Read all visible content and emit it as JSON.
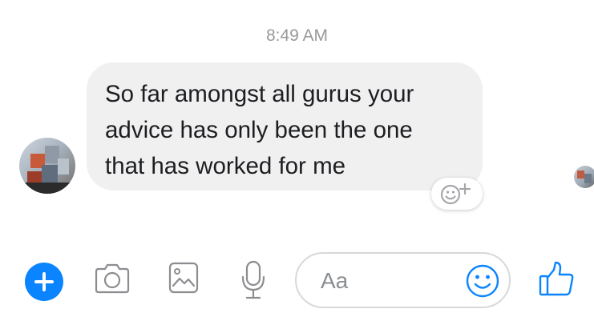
{
  "conversation": {
    "timestamp": "8:49 AM",
    "message": {
      "lines": [
        "So far amongst all gurus your",
        "advice has only been the one",
        "that has worked for me"
      ]
    }
  },
  "composer": {
    "input_placeholder": "Aa"
  },
  "colors": {
    "accent": "#0a84ff",
    "bubble": "#f1f0f0",
    "timestamp": "#999999"
  },
  "icons": [
    "plus-icon",
    "camera-icon",
    "gallery-icon",
    "microphone-icon",
    "emoji-icon",
    "thumbs-up-icon",
    "add-reaction-icon"
  ]
}
